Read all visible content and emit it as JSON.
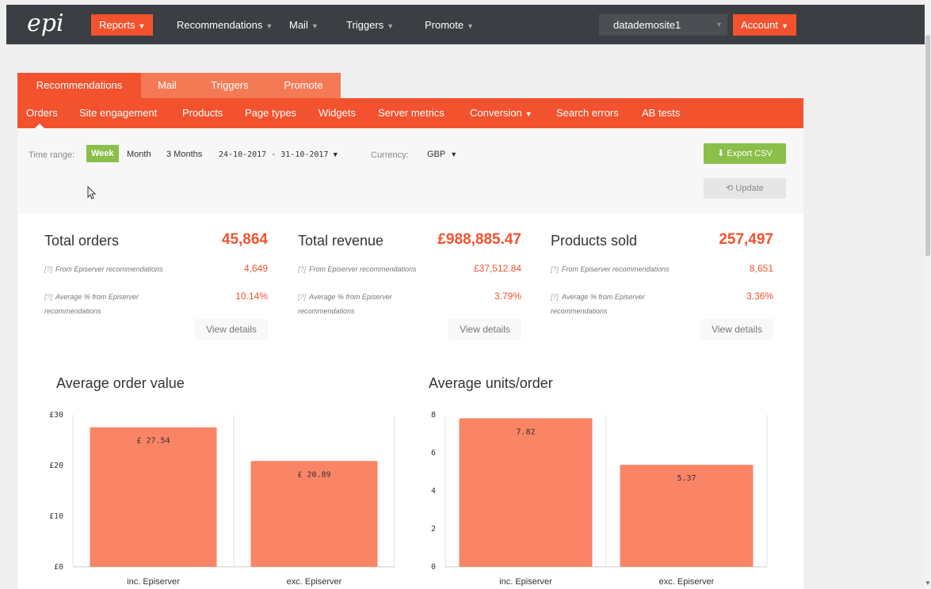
{
  "topnav": {
    "logo": "epi",
    "items": [
      {
        "label": "Reports",
        "active": true
      },
      {
        "label": "Recommendations",
        "active": false
      },
      {
        "label": "Mail",
        "active": false
      },
      {
        "label": "Triggers",
        "active": false
      },
      {
        "label": "Promote",
        "active": false
      }
    ],
    "site": "datademosite1",
    "account": "Account"
  },
  "tabs": [
    "Recommendations",
    "Mail",
    "Triggers",
    "Promote"
  ],
  "subnav": [
    "Orders",
    "Site engagement",
    "Products",
    "Page types",
    "Widgets",
    "Server metrics",
    "Conversion",
    "Search errors",
    "AB tests"
  ],
  "controls": {
    "time_range_label": "Time range:",
    "week": "Week",
    "month": "Month",
    "three_months": "3 Months",
    "date_range": "24-10-2017 - 31-10-2017",
    "currency_label": "Currency:",
    "currency": "GBP",
    "export": "Export CSV",
    "update": "Update"
  },
  "stats": [
    {
      "title": "Total orders",
      "value": "45,864",
      "from_label": "From Episerver recommendations",
      "from_value": "4,649",
      "avg_label_1": "Average % from Episerver",
      "avg_label_2": "recommendations",
      "avg_value": "10.14%",
      "details": "View details"
    },
    {
      "title": "Total revenue",
      "value": "£988,885.47",
      "from_label": "From Episerver recommendations",
      "from_value": "£37,512.84",
      "avg_label_1": "Average % from Episerver",
      "avg_label_2": "recommendations",
      "avg_value": "3.79%",
      "details": "View details"
    },
    {
      "title": "Products sold",
      "value": "257,497",
      "from_label": "From Episerver recommendations",
      "from_value": "8,651",
      "avg_label_1": "Average % from Episerver",
      "avg_label_2": "recommendations",
      "avg_value": "3.36%",
      "details": "View details"
    }
  ],
  "qmark": "[?]",
  "chart_data": [
    {
      "type": "bar",
      "title": "Average order value",
      "categories": [
        "inc. Episerver",
        "exc. Episerver"
      ],
      "values": [
        27.54,
        20.89
      ],
      "data_labels": [
        "£ 27.54",
        "£ 20.89"
      ],
      "yticks": [
        0,
        10,
        20,
        30
      ],
      "ytick_labels": [
        "£0",
        "£10",
        "£20",
        "£30"
      ],
      "ylim": [
        0,
        30
      ],
      "bar_color": "#fa8566"
    },
    {
      "type": "bar",
      "title": "Average units/order",
      "categories": [
        "inc. Episerver",
        "exc. Episerver"
      ],
      "values": [
        7.82,
        5.37
      ],
      "data_labels": [
        "7.82",
        "5.37"
      ],
      "yticks": [
        0,
        2,
        4,
        6,
        8
      ],
      "ytick_labels": [
        "0",
        "2",
        "4",
        "6",
        "8"
      ],
      "ylim": [
        0,
        8
      ],
      "bar_color": "#fa8566"
    }
  ],
  "colors": {
    "accent": "#f2522e",
    "green": "#8bbf4a",
    "nav": "#3b3e42"
  }
}
